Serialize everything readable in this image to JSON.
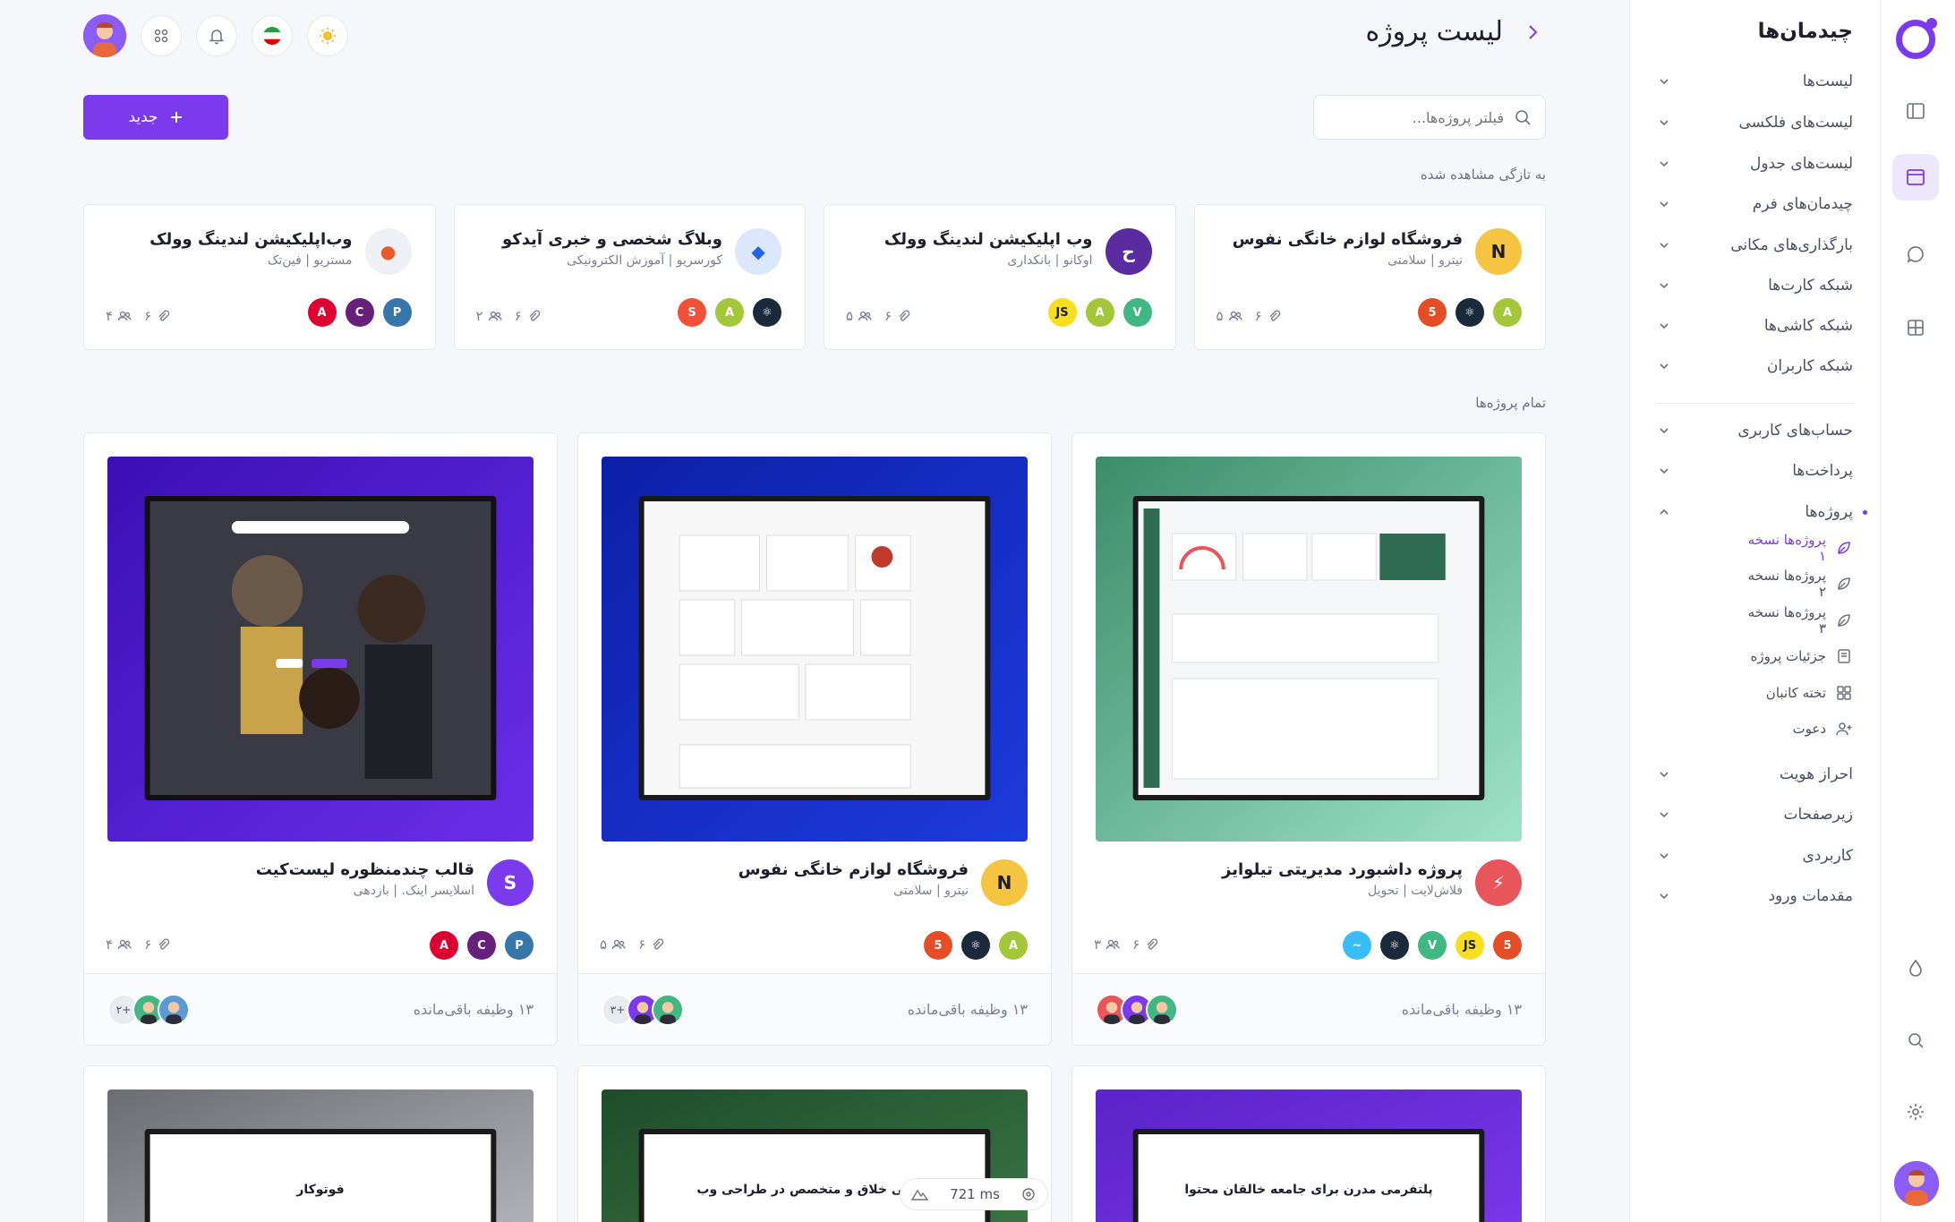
{
  "sidebar": {
    "title": "چیدمان‌ها",
    "items": [
      {
        "label": "لیست‌ها"
      },
      {
        "label": "لیست‌های فلکسی"
      },
      {
        "label": "لیست‌های جدول"
      },
      {
        "label": "چیدمان‌های فرم"
      },
      {
        "label": "بارگذاری‌های مکانی"
      },
      {
        "label": "شبکه کارت‌ها"
      },
      {
        "label": "شبکه کاشی‌ها"
      },
      {
        "label": "شبکه کاربران"
      }
    ],
    "items2": [
      {
        "label": "حساب‌های کاربری"
      },
      {
        "label": "پرداخت‌ها"
      },
      {
        "label": "پروژه‌ها"
      }
    ],
    "sub_items": [
      {
        "label": "پروژه‌ها نسخه ۱"
      },
      {
        "label": "پروژه‌ها نسخه ۲"
      },
      {
        "label": "پروژه‌ها نسخه ۳"
      },
      {
        "label": "جزئیات پروژه"
      },
      {
        "label": "تخته کانبان"
      },
      {
        "label": "دعوت"
      }
    ],
    "items3": [
      {
        "label": "احراز هویت"
      },
      {
        "label": "زیرصفحات"
      },
      {
        "label": "کاربردی"
      },
      {
        "label": "مقدمات ورود"
      }
    ]
  },
  "header": {
    "title": "لیست پروژه"
  },
  "search": {
    "placeholder": "فیلتر پروژه‌ها..."
  },
  "new_button": {
    "label": "جدید"
  },
  "recent": {
    "label": "به تازگی مشاهده شده",
    "cards": [
      {
        "name": "فروشگاه لوازم خانگی نفوس",
        "sub": "نیترو | سلامتی",
        "logo": "N",
        "logo_color": "#f5c542",
        "logo_text_color": "#1e1e2d",
        "files": "۶",
        "members": "۵",
        "techs": [
          {
            "t": "A",
            "c": "#a4c639"
          },
          {
            "t": "⚛",
            "c": "#1b2a3a"
          },
          {
            "t": "5",
            "c": "#e44d26"
          }
        ]
      },
      {
        "name": "وب اپلیکیشن لندینگ وولک",
        "sub": "اوکانو | بانکداری",
        "logo": "ح",
        "logo_color": "#5b2c9f",
        "logo_text_color": "#ffffff",
        "files": "۶",
        "members": "۵",
        "techs": [
          {
            "t": "V",
            "c": "#41b883"
          },
          {
            "t": "A",
            "c": "#a4c639"
          },
          {
            "t": "JS",
            "c": "#f7df1e"
          }
        ]
      },
      {
        "name": "وبلاگ شخصی و خبری آیدکو",
        "sub": "کورسریو | آموزش الکترونیکی",
        "logo": "◆",
        "logo_color": "#dbe7fb",
        "logo_text_color": "#2563eb",
        "files": "۶",
        "members": "۲",
        "techs": [
          {
            "t": "⚛",
            "c": "#1b2a3a"
          },
          {
            "t": "A",
            "c": "#a4c639"
          },
          {
            "t": "S",
            "c": "#f05138"
          }
        ]
      },
      {
        "name": "وب‌اپلیکیشن لندینگ وولک",
        "sub": "مستریو | فین‌تک",
        "logo": "●",
        "logo_color": "#eef0f5",
        "logo_text_color": "#e85a2c",
        "files": "۶",
        "members": "۴",
        "techs": [
          {
            "t": "P",
            "c": "#3776ab"
          },
          {
            "t": "C",
            "c": "#68217a"
          },
          {
            "t": "A",
            "c": "#dd0031"
          }
        ]
      }
    ]
  },
  "all": {
    "label": "تمام پروژه‌ها",
    "cards": [
      {
        "name": "پروژه داشبورد مدیریتی تیلوایز",
        "sub": "فلاش‌لایت | تحویل",
        "logo": "⚡",
        "logo_color": "#e8555a",
        "logo_text_color": "#ffffff",
        "files": "۶",
        "members": "۳",
        "tasks": "۱۳ وظیفه باقی‌مانده",
        "extra": "",
        "thumb_from": "#3c8c6c",
        "thumb_to": "#9fe3c9",
        "techs": [
          {
            "t": "5",
            "c": "#e44d26"
          },
          {
            "t": "JS",
            "c": "#f7df1e"
          },
          {
            "t": "V",
            "c": "#41b883"
          },
          {
            "t": "⚛",
            "c": "#1b2a3a"
          },
          {
            "t": "~",
            "c": "#38bdf8"
          }
        ]
      },
      {
        "name": "فروشگاه لوازم خانگی نفوس",
        "sub": "نیترو | سلامتی",
        "logo": "N",
        "logo_color": "#f5c542",
        "logo_text_color": "#1e1e2d",
        "files": "۶",
        "members": "۵",
        "tasks": "۱۳ وظیفه باقی‌مانده",
        "extra": "۳+",
        "thumb_from": "#0c1fa8",
        "thumb_to": "#1d3bdc",
        "techs": [
          {
            "t": "A",
            "c": "#a4c639"
          },
          {
            "t": "⚛",
            "c": "#1b2a3a"
          },
          {
            "t": "5",
            "c": "#e44d26"
          }
        ]
      },
      {
        "name": "قالب چندمنظوره لیست‌کیت",
        "sub": "اسلایسر اینک. | بازدهی",
        "logo": "S",
        "logo_color": "#7c3aed",
        "logo_text_color": "#ffffff",
        "files": "۶",
        "members": "۴",
        "tasks": "۱۳ وظیفه باقی‌مانده",
        "extra": "۲+",
        "thumb_from": "#3b0fb5",
        "thumb_to": "#6b2ee8",
        "techs": [
          {
            "t": "P",
            "c": "#3776ab"
          },
          {
            "t": "C",
            "c": "#68217a"
          },
          {
            "t": "A",
            "c": "#dd0031"
          }
        ]
      }
    ],
    "row2": [
      {
        "thumb_from": "#5b23c9",
        "thumb_to": "#7c3aed",
        "headline": "پلتفرمی مدرن برای جامعه خالقان محتوا"
      },
      {
        "thumb_from": "#1e4d2a",
        "thumb_to": "#3d7a45",
        "headline": "تیفاتی خلاق و متخصص در طراحی وب"
      },
      {
        "thumb_from": "#6b6d72",
        "thumb_to": "#b9bbc1",
        "headline": "فوتوکار"
      }
    ]
  },
  "perf": {
    "value": "721",
    "unit": "ms"
  },
  "colors": {
    "accent": "#7c3aed",
    "background": "#f6f7fb"
  }
}
